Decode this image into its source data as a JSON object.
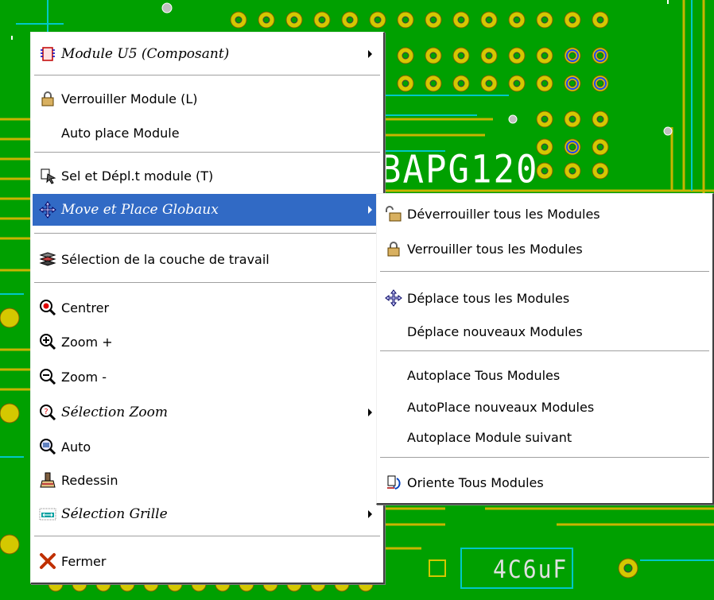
{
  "board": {
    "silkscreen_text": "BAPG120",
    "part_label": "4C6uF"
  },
  "context_menu": {
    "items": [
      {
        "label": "Module U5 (Composant)",
        "icon": "chip-icon",
        "submenu": true,
        "italic": true
      },
      {
        "label": "Verrouiller Module (L)",
        "icon": "padlock-icon"
      },
      {
        "label": "Auto place Module",
        "icon": ""
      },
      {
        "label": "Sel et Dépl.t module (T)",
        "icon": "select-move-icon"
      },
      {
        "label": "Move et Place Globaux",
        "icon": "move-cross-icon",
        "submenu": true,
        "italic": true,
        "highlighted": true
      },
      {
        "label": "Sélection de la couche de travail",
        "icon": "layers-icon"
      },
      {
        "label": "Centrer",
        "icon": "center-magnifier-icon"
      },
      {
        "label": "Zoom +",
        "icon": "zoom-in-icon"
      },
      {
        "label": "Zoom -",
        "icon": "zoom-out-icon"
      },
      {
        "label": "Sélection Zoom",
        "icon": "zoom-select-icon",
        "submenu": true,
        "italic": true
      },
      {
        "label": "Auto",
        "icon": "zoom-auto-icon"
      },
      {
        "label": "Redessin",
        "icon": "redraw-icon"
      },
      {
        "label": "Sélection Grille",
        "icon": "grid-icon",
        "submenu": true,
        "italic": true
      },
      {
        "label": "Fermer",
        "icon": "close-x-icon"
      }
    ]
  },
  "submenu": {
    "items": [
      {
        "label": "Déverrouiller tous les Modules",
        "icon": "unlock-icon"
      },
      {
        "label": "Verrouiller tous les Modules",
        "icon": "padlock-icon"
      },
      {
        "label": "Déplace tous les Modules",
        "icon": "move-cross-icon"
      },
      {
        "label": "Déplace nouveaux Modules",
        "icon": ""
      },
      {
        "label": "Autoplace Tous Modules",
        "icon": ""
      },
      {
        "label": "AutoPlace nouveaux Modules",
        "icon": ""
      },
      {
        "label": "Autoplace Module suivant",
        "icon": ""
      },
      {
        "label": "Oriente Tous Modules",
        "icon": "orient-icon"
      }
    ]
  },
  "colors": {
    "board_background": "#00a000",
    "highlight": "#316ac5",
    "track_yellow": "#c8b400",
    "pad_yellow": "#d4c800",
    "via_cyan": "#00c8c8"
  }
}
